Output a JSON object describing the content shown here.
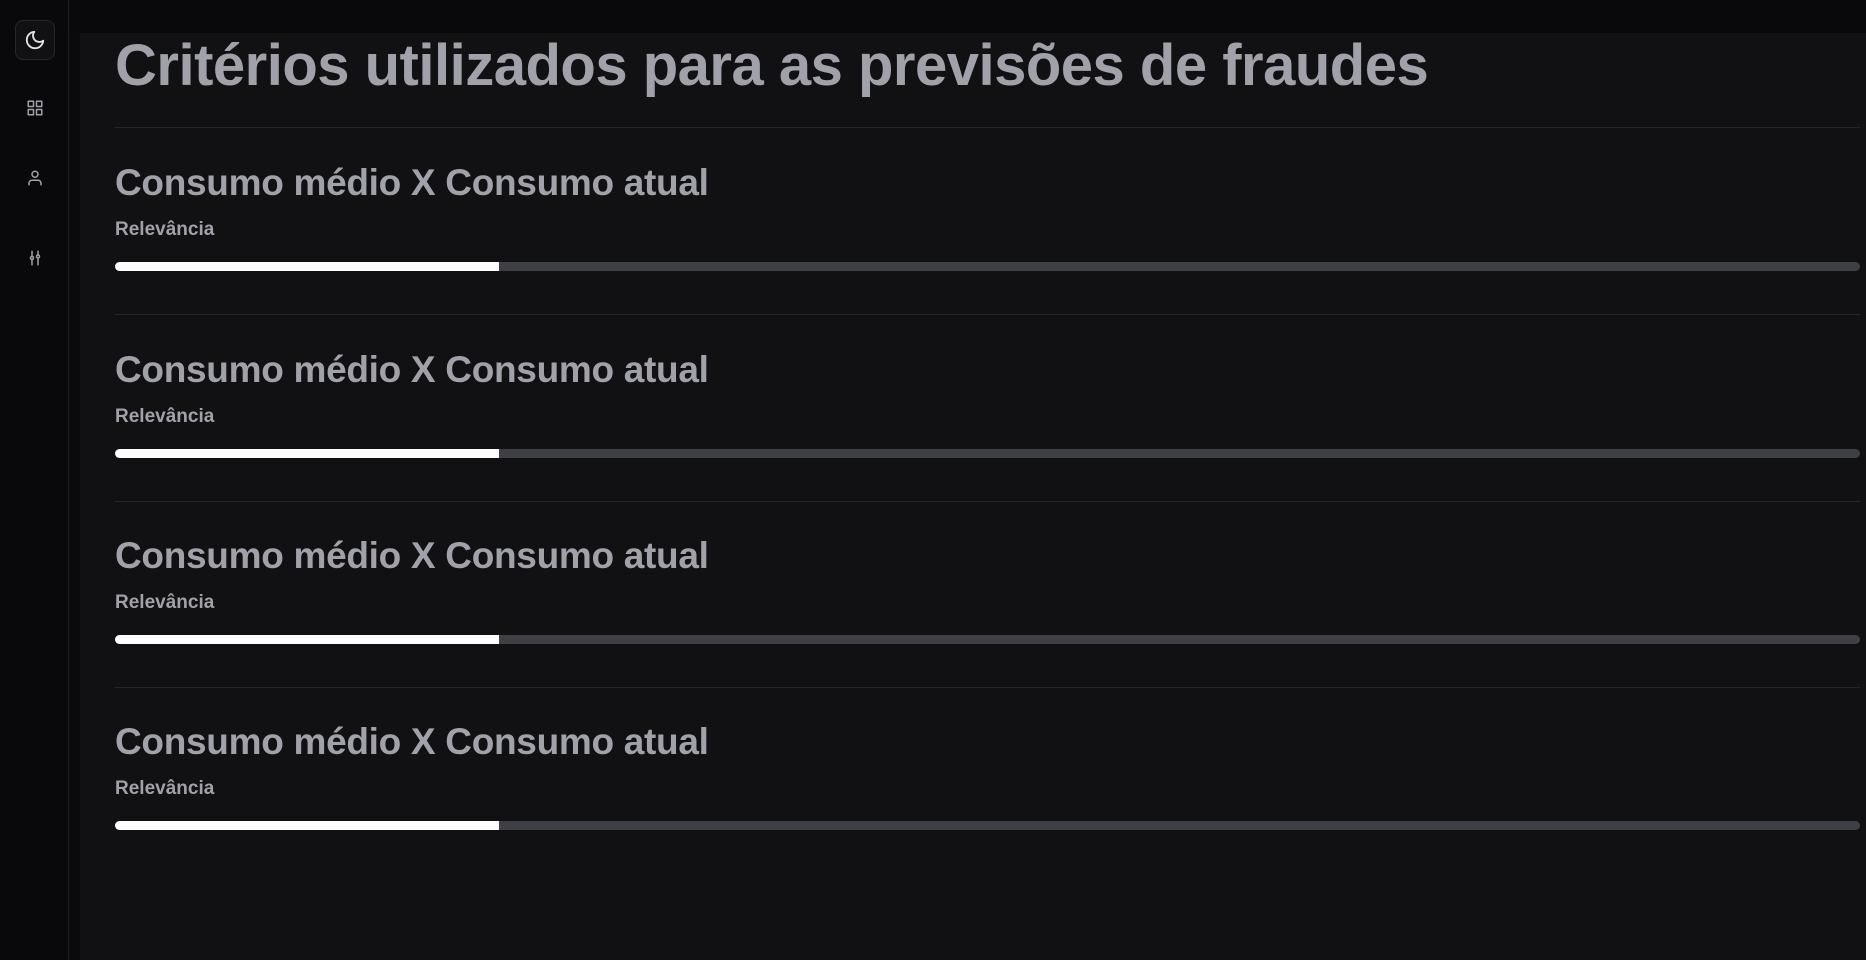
{
  "sidebar": {
    "items": [
      {
        "icon": "moon-icon",
        "active": true
      },
      {
        "icon": "grid-icon",
        "active": false
      },
      {
        "icon": "user-icon",
        "active": false
      },
      {
        "icon": "sliders-icon",
        "active": false
      }
    ]
  },
  "page": {
    "title": "Critérios utilizados para as previsões de fraudes"
  },
  "criteria": [
    {
      "title": "Consumo médio X Consumo atual",
      "label": "Relevância",
      "relevance": 0.22
    },
    {
      "title": "Consumo médio X Consumo atual",
      "label": "Relevância",
      "relevance": 0.22
    },
    {
      "title": "Consumo médio X Consumo atual",
      "label": "Relevância",
      "relevance": 0.22
    },
    {
      "title": "Consumo médio X Consumo atual",
      "label": "Relevância",
      "relevance": 0.22
    }
  ],
  "colors": {
    "background": "#111113",
    "sidebar": "#09090b",
    "text_muted": "#a1a1aa",
    "bar_fill": "#ffffff",
    "bar_track": "#3f3f46"
  }
}
